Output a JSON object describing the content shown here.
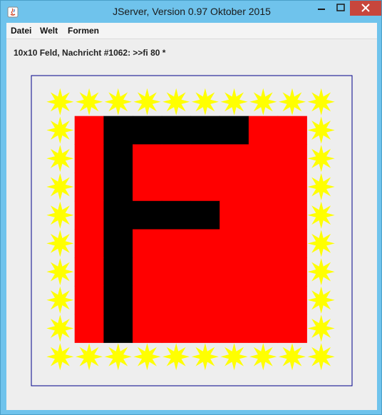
{
  "window": {
    "title": "JServer, Version 0.97 Oktober 2015"
  },
  "menu": {
    "items": [
      "Datei",
      "Welt",
      "Formen"
    ]
  },
  "status": {
    "text": "10x10 Feld, Nachricht #1062: >>fi 80 *"
  },
  "field": {
    "rows": 10,
    "cols": 10,
    "background_color": "#ff0000",
    "shape_color": "#000000",
    "star_color": "#ffff00",
    "frame_color": "#00008b",
    "cells": [
      "S S S S S S S S S S",
      "S R B B B B B R R S",
      "S R B R R R R R R S",
      "S R B R R R R R R S",
      "S R B B B B R R R S",
      "S R B R R R R R R S",
      "S R B R R R R R R S",
      "S R B R R R R R R S",
      "S R B R R R R R R S",
      "S S S S S S S S S S"
    ]
  }
}
